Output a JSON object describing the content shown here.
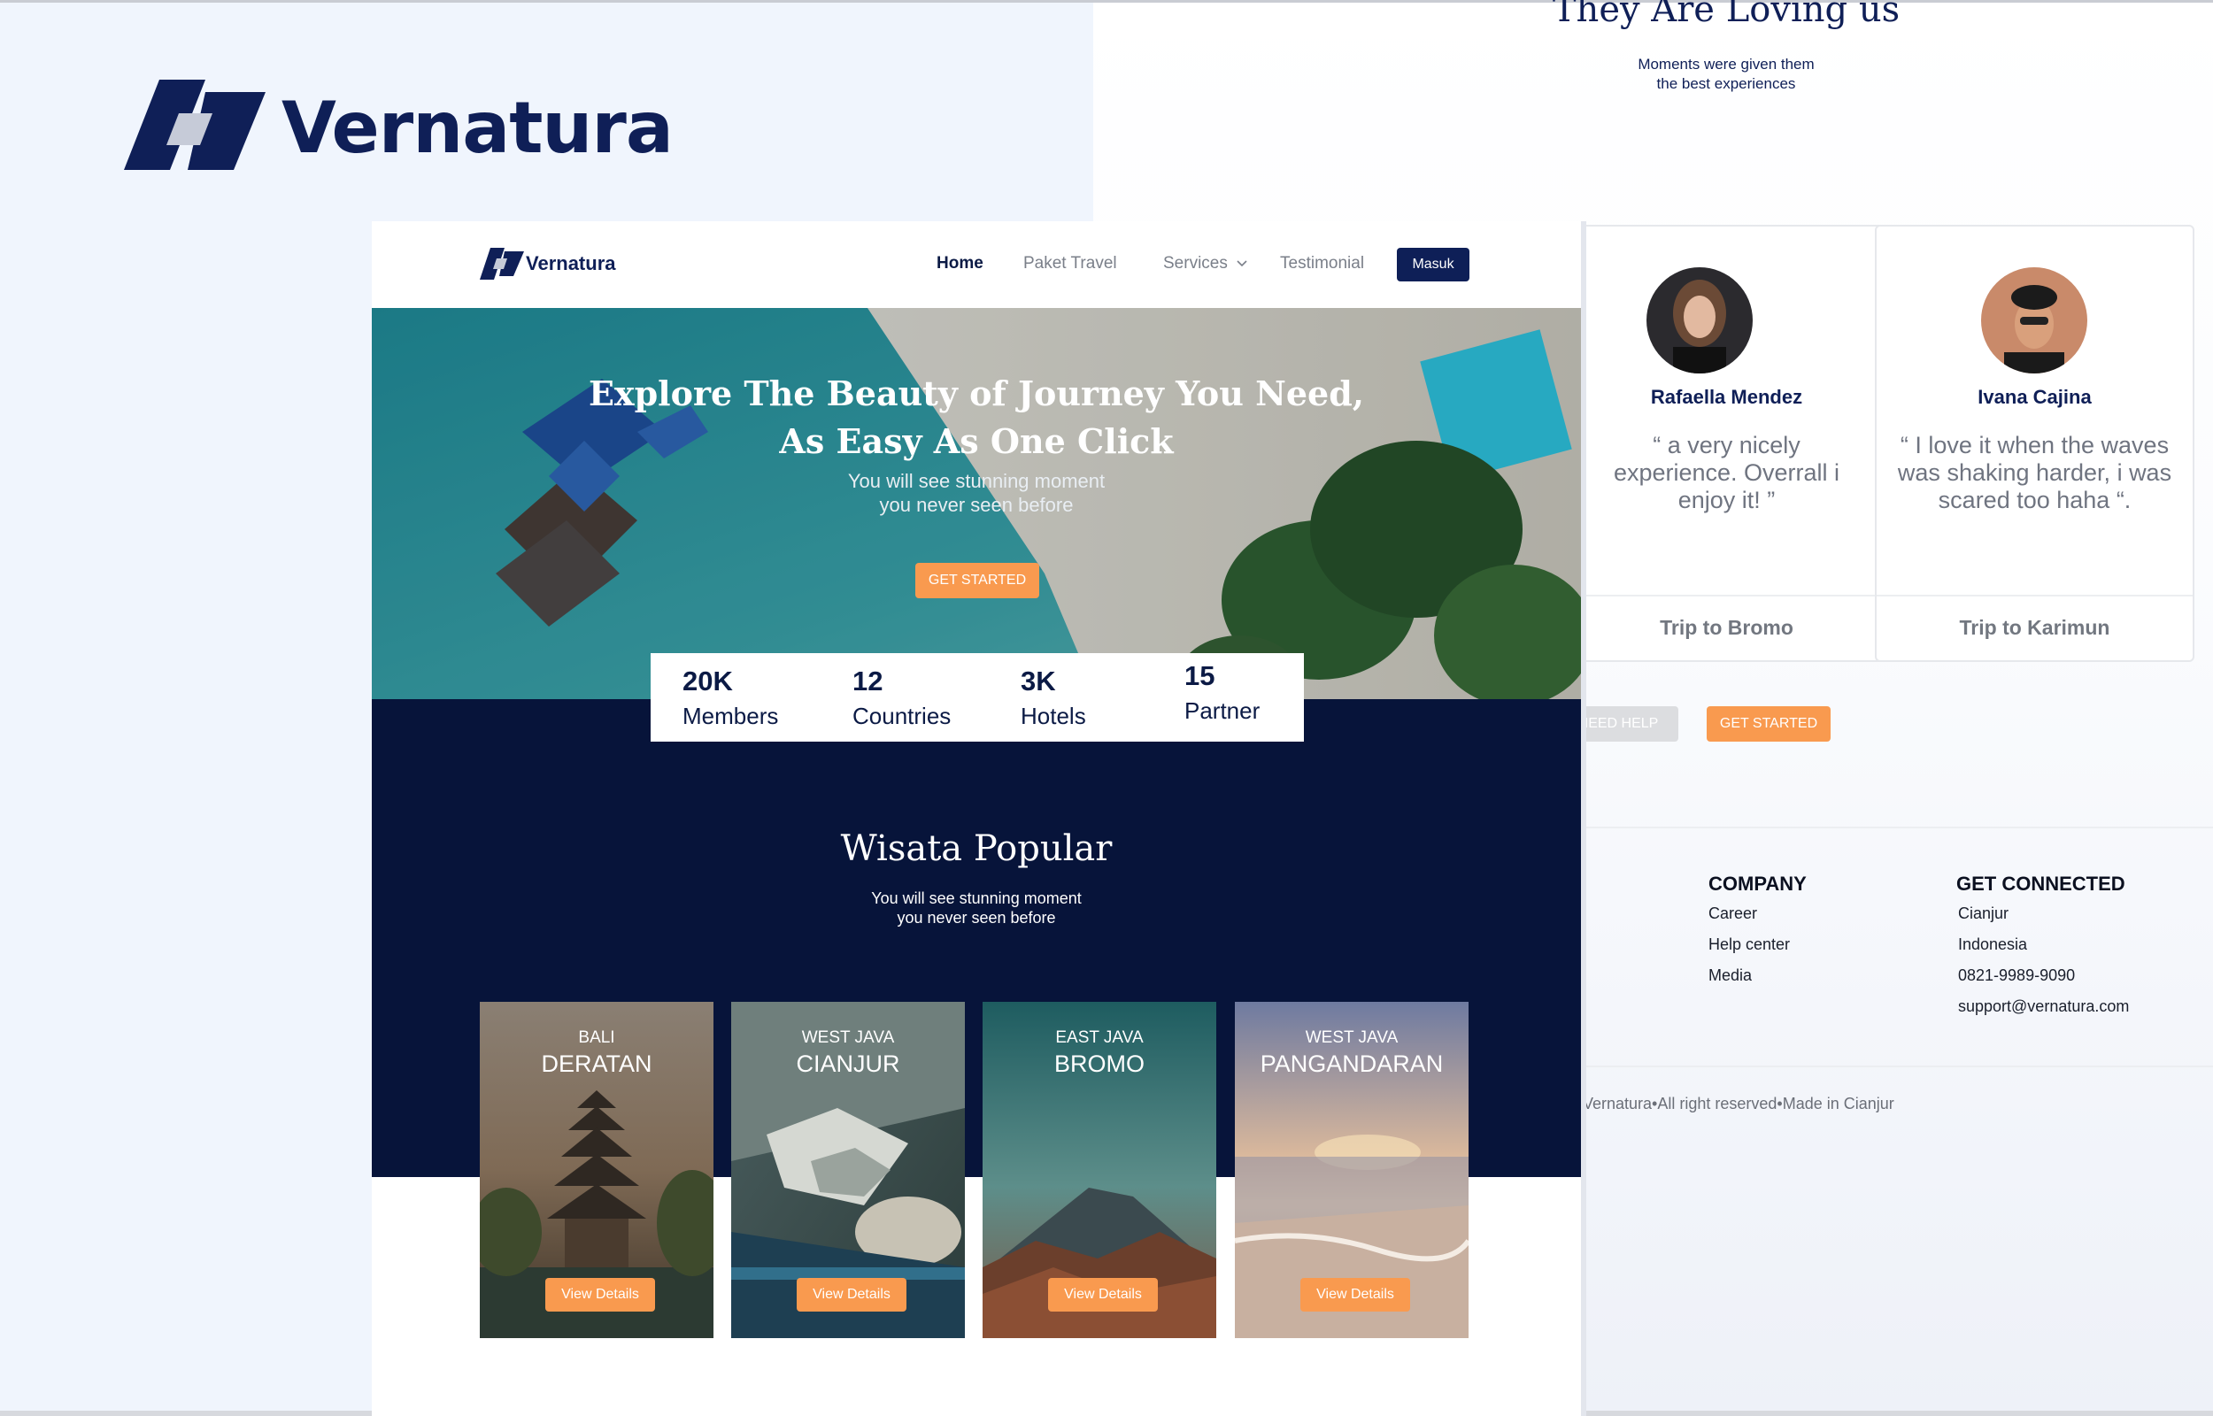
{
  "brand": {
    "name": "Vernatura"
  },
  "testimonials": {
    "title": "They Are Loving us",
    "subtitle_line1": "Moments were given them",
    "subtitle_line2": "the best experiences",
    "cards": [
      {
        "name": "Rafaella Mendez",
        "quote_line1": "“ a very nicely",
        "quote_line2": "experience. Overrall i",
        "quote_line3": "enjoy it! ”",
        "trip": "Trip to Bromo"
      },
      {
        "name": "Ivana Cajina",
        "quote_line1": "“ I love it when the waves",
        "quote_line2": "was shaking harder, i was",
        "quote_line3": "scared too haha “.",
        "trip": "Trip to Karimun"
      }
    ],
    "need_help_label": "NEED HELP",
    "get_started_label": "GET STARTED"
  },
  "footer": {
    "company": {
      "heading": "COMPANY",
      "items": [
        "Career",
        "Help center",
        "Media"
      ]
    },
    "connected": {
      "heading": "GET CONNECTED",
      "items": [
        "Cianjur",
        "Indonesia",
        "0821-9989-9090",
        "support@vernatura.com"
      ]
    },
    "copyright": "t Vernatura•All right reserved•Made in Cianjur"
  },
  "nav": {
    "brand": "Vernatura",
    "items": [
      "Home",
      "Paket Travel",
      "Services",
      "Testimonial"
    ],
    "login_label": "Masuk"
  },
  "hero": {
    "title_line1": "Explore The Beauty of Journey You Need,",
    "title_line2": "As Easy As One Click",
    "subtitle_line1": "You will see stunning moment",
    "subtitle_line2": "you never seen before",
    "cta_label": "GET STARTED"
  },
  "stats": [
    {
      "value": "20K",
      "label": "Members"
    },
    {
      "value": "12",
      "label": "Countries"
    },
    {
      "value": "3K",
      "label": "Hotels"
    },
    {
      "value": "15",
      "label": "Partner"
    }
  ],
  "popular": {
    "title": "Wisata Popular",
    "subtitle_line1": "You will see stunning moment",
    "subtitle_line2": "you never seen before",
    "destinations": [
      {
        "region": "BALI",
        "place": "DERATAN",
        "cta": "View Details"
      },
      {
        "region": "WEST JAVA",
        "place": "CIANJUR",
        "cta": "View Details"
      },
      {
        "region": "EAST JAVA",
        "place": "BROMO",
        "cta": "View Details"
      },
      {
        "region": "WEST JAVA",
        "place": "PANGANDARAN",
        "cta": "View Details"
      }
    ]
  },
  "colors": {
    "navy": "#07143a",
    "brand": "#0f1f57",
    "accent_orange": "#f99a4f"
  }
}
